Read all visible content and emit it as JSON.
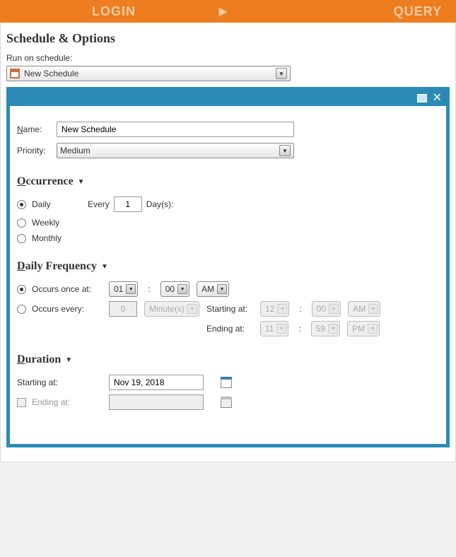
{
  "topbar": {
    "login": "LOGIN",
    "query": "QUERY"
  },
  "page": {
    "title": "Schedule & Options",
    "run_on_label": "Run on schedule:",
    "schedule_combo": "New Schedule"
  },
  "dialog": {
    "name_label": "Name:",
    "name_value": "New Schedule",
    "priority_label": "Priority:",
    "priority_value": "Medium",
    "occurrence": {
      "title": "ccurrence",
      "mnemonic": "O",
      "daily": "Daily",
      "weekly": "Weekly",
      "monthly": "Monthly",
      "every": "Every",
      "every_value": "1",
      "days_suffix": "Day(s):"
    },
    "frequency": {
      "title": "aily Frequency",
      "mnemonic": "D",
      "once_label": "Occurs once at:",
      "every_label": "Occurs every:",
      "once_hour": "01",
      "once_min": "00",
      "once_ampm": "AM",
      "every_value": "0",
      "every_unit": "Minute(s)",
      "starting_label": "Starting at:",
      "ending_label": "Ending at:",
      "start_h": "12",
      "start_m": "00",
      "start_ap": "AM",
      "end_h": "11",
      "end_m": "59",
      "end_ap": "PM"
    },
    "duration": {
      "title": "uration",
      "mnemonic": "D",
      "starting_label": "Starting at:",
      "starting_value": "Nov 19, 2018",
      "ending_label": "Ending at:"
    }
  }
}
